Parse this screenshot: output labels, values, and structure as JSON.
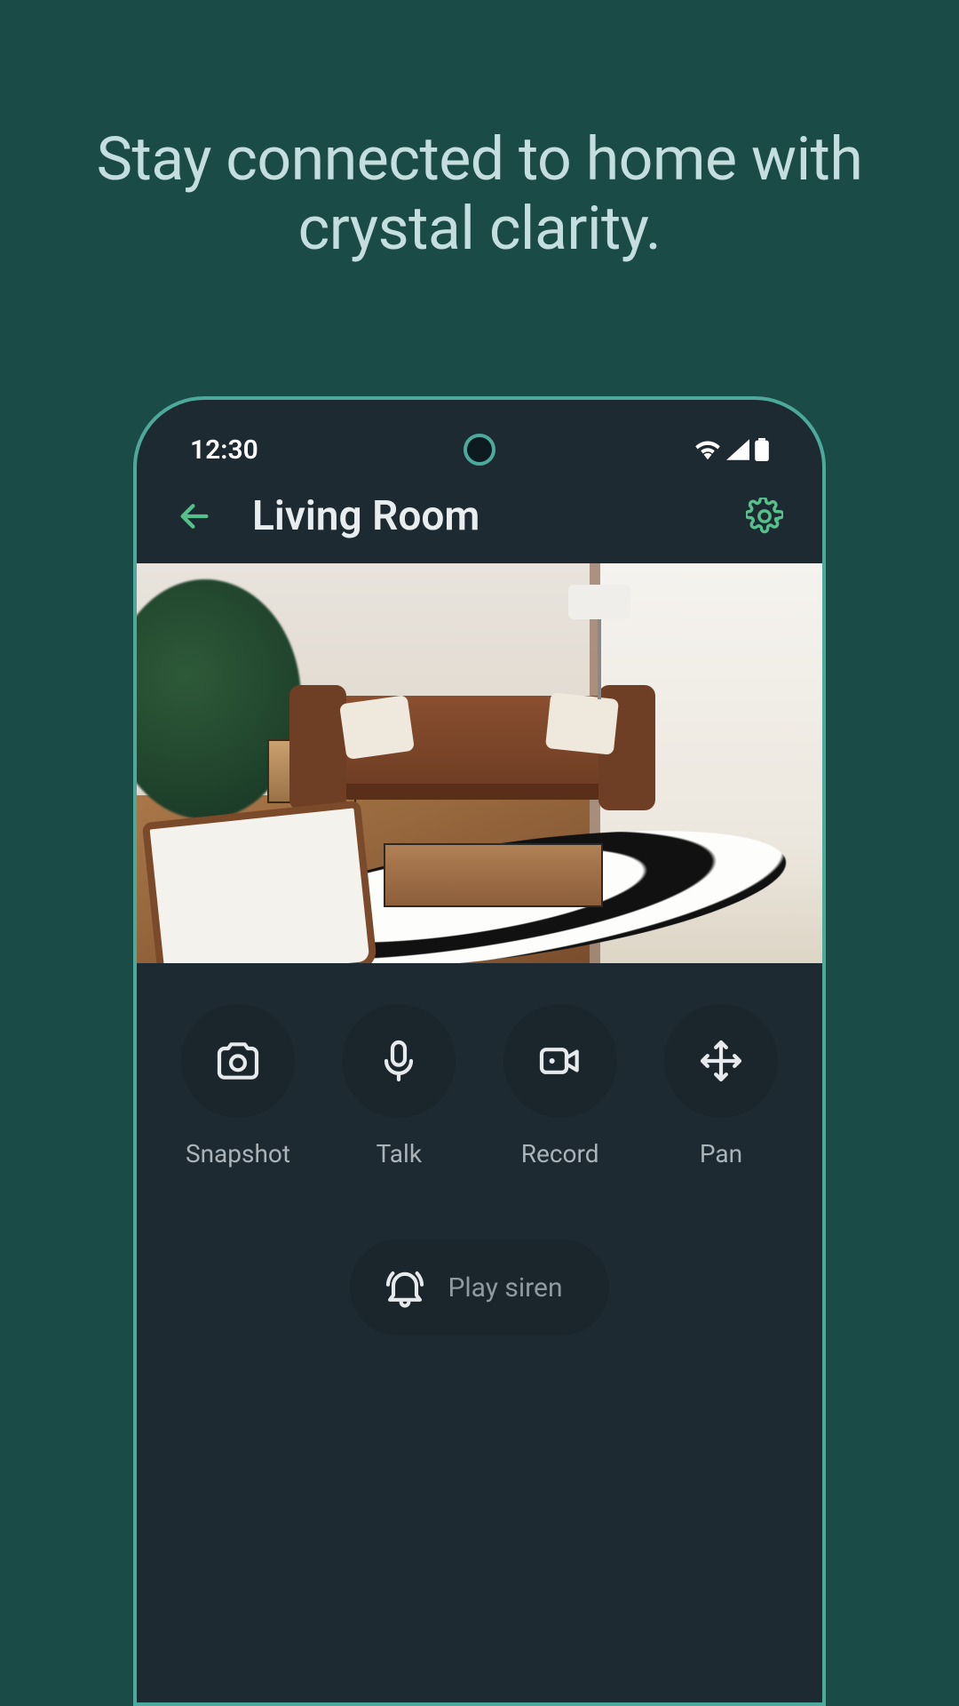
{
  "marketing": {
    "headline": "Stay connected to home with crystal clarity."
  },
  "status": {
    "time": "12:30"
  },
  "header": {
    "title": "Living Room"
  },
  "controls": {
    "snapshot": "Snapshot",
    "talk": "Talk",
    "record": "Record",
    "pan": "Pan"
  },
  "siren": {
    "label": "Play siren"
  },
  "colors": {
    "accent": "#4ca99b",
    "bg": "#1b4b47"
  }
}
